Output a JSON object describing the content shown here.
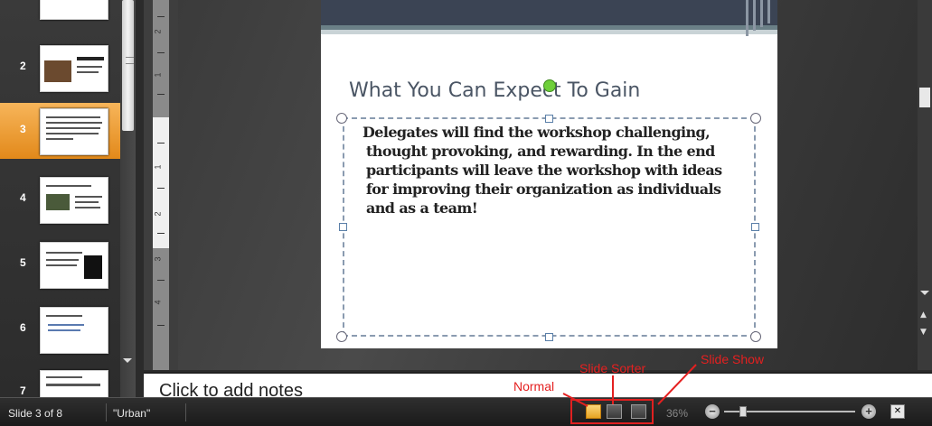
{
  "status_bar": {
    "slide_counter": "Slide 3 of 8",
    "theme": "\"Urban\"",
    "zoom": "36%",
    "zoom_level_percent": 36
  },
  "thumbnails": {
    "items": [
      {
        "num": "2"
      },
      {
        "num": "3",
        "selected": true
      },
      {
        "num": "4"
      },
      {
        "num": "5"
      },
      {
        "num": "6"
      },
      {
        "num": "7"
      }
    ]
  },
  "slide": {
    "title": "What You Can Expect To Gain",
    "body_lines": [
      "Delegates will find the workshop challenging,",
      "thought provoking, and rewarding. In the end",
      "participants will leave the workshop with ideas",
      "for improving their organization as individuals",
      "and as a team!"
    ]
  },
  "ruler": {
    "numbers": [
      "2",
      "1",
      "1",
      "2",
      "3",
      "4"
    ]
  },
  "notes": {
    "placeholder": "Click to add notes"
  },
  "annotations": {
    "normal": "Normal",
    "slide_sorter": "Slide Sorter",
    "slide_show": "Slide Show"
  },
  "colors": {
    "annotation": "#e42020",
    "selected_thumbnail": "#f0a040",
    "title_band": "#3b4454"
  }
}
